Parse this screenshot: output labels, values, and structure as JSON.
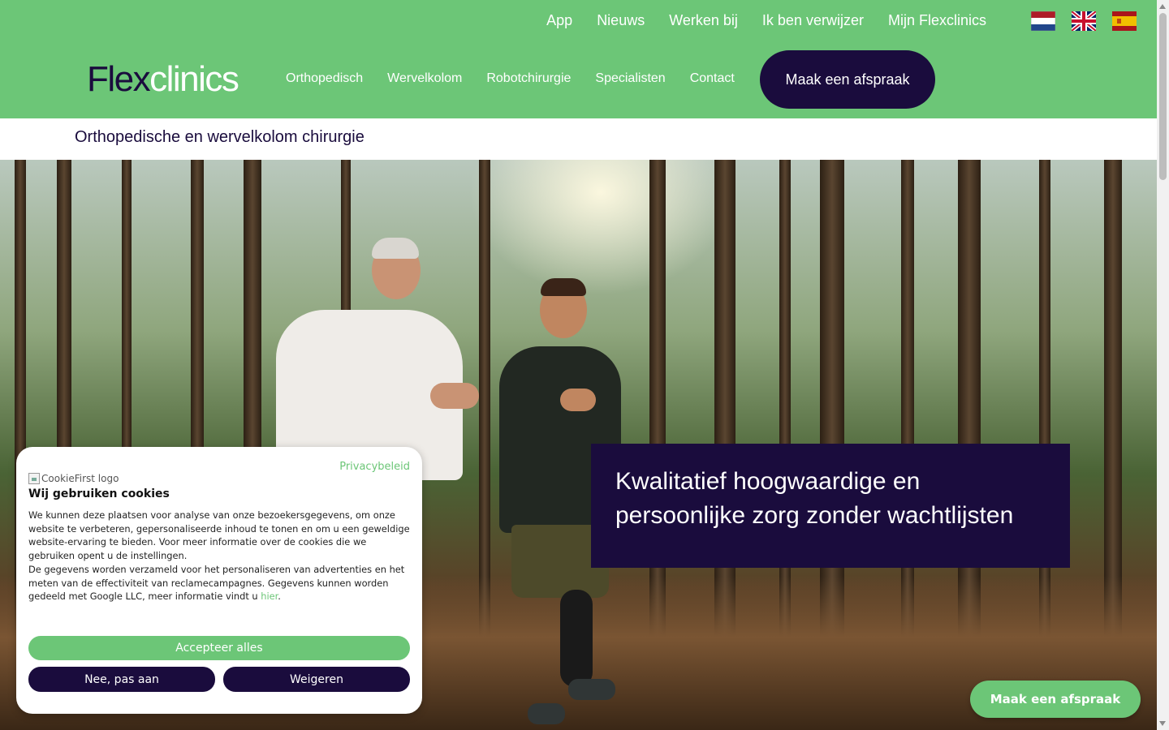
{
  "topnav": {
    "items": [
      "App",
      "Nieuws",
      "Werken bij",
      "Ik ben verwijzer",
      "Mijn Flexclinics"
    ]
  },
  "languages": [
    {
      "name": "nl-flag-icon",
      "colors": [
        "#ae1c28",
        "#ffffff",
        "#21468b"
      ]
    },
    {
      "name": "uk-flag-icon",
      "colors": [
        "#012169",
        "#ffffff",
        "#c8102e"
      ]
    },
    {
      "name": "es-flag-icon",
      "colors": [
        "#aa151b",
        "#f1bf00"
      ]
    }
  ],
  "logo": {
    "part1": "Flex",
    "part2": "clinics"
  },
  "mainnav": {
    "items": [
      "Orthopedisch",
      "Wervelkolom",
      "Robotchirurgie",
      "Specialisten",
      "Contact"
    ]
  },
  "header": {
    "cta_label": "Maak een afspraak"
  },
  "subheader": {
    "title": "Orthopedische en wervelkolom chirurgie"
  },
  "hero": {
    "headline": "Kwalitatief hoogwaardige en persoonlijke zorg zonder wachtlijsten"
  },
  "cookie": {
    "privacy_link": "Privacybeleid",
    "logo_alt": "CookieFirst logo",
    "title": "Wij gebruiken cookies",
    "paragraph1": "We kunnen deze plaatsen voor analyse van onze bezoekersgegevens, om onze website te verbeteren, gepersonaliseerde inhoud te tonen en om u een geweldige website-ervaring te bieden. Voor meer informatie over de cookies die we gebruiken opent u de instellingen.",
    "paragraph2": "De gegevens worden verzameld voor het personaliseren van advertenties en het meten van de effectiviteit van reclamecampagnes. Gegevens kunnen worden gedeeld met Google LLC, meer informatie vindt u ",
    "link_here": "hier",
    "period": ".",
    "accept_label": "Accepteer alles",
    "adjust_label": "Nee, pas aan",
    "refuse_label": "Weigeren"
  },
  "fab": {
    "label": "Maak een afspraak"
  },
  "colors": {
    "brand_green": "#6cc677",
    "brand_navy": "#1a0c3d"
  }
}
